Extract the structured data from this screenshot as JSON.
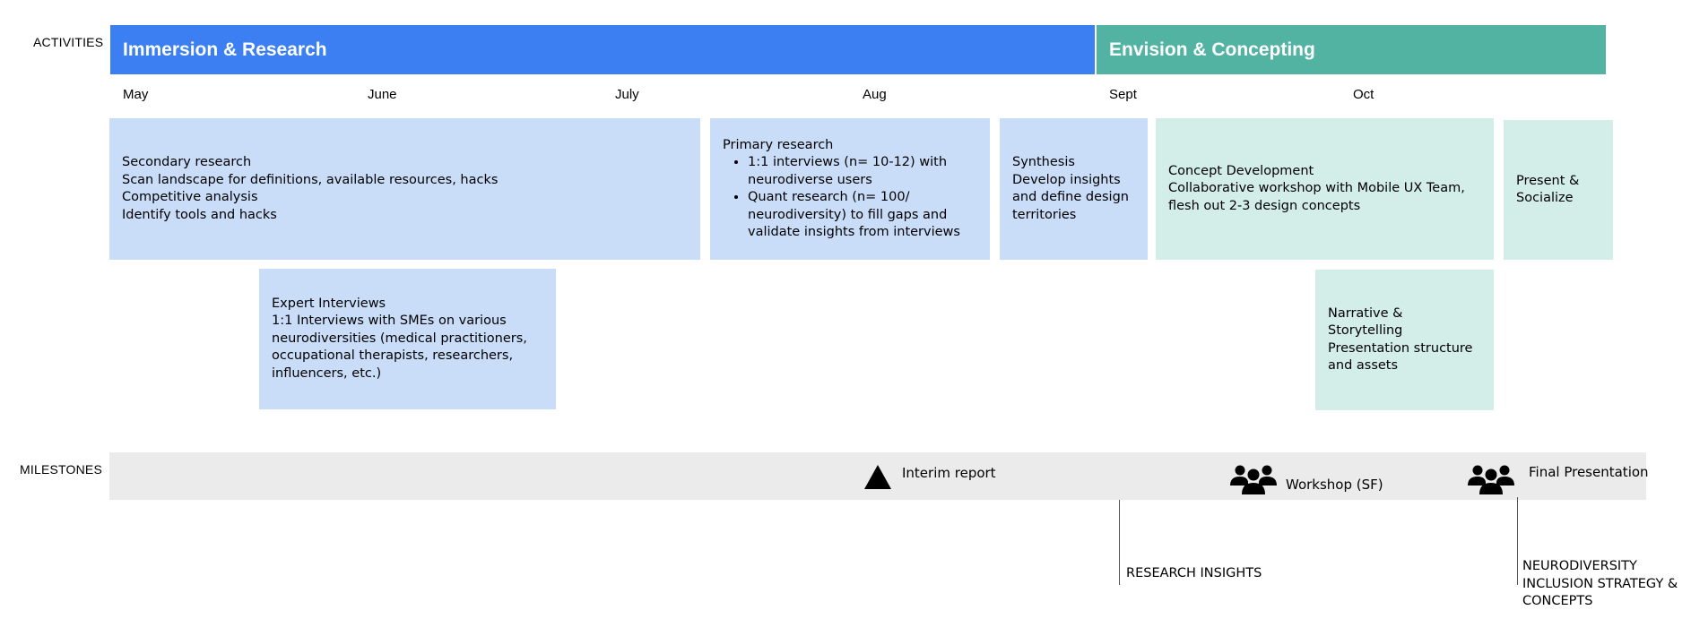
{
  "labels": {
    "activities": "ACTIVITIES",
    "milestones": "MILESTONES"
  },
  "colors": {
    "immersion": "#3b7ff2",
    "envision": "#52b3a3",
    "research_box": "#c9dcf8",
    "concept_box": "#d3ede8",
    "milestone_band": "#ebebeb"
  },
  "phases": {
    "immersion": "Immersion & Research",
    "envision": "Envision & Concepting"
  },
  "months": [
    "May",
    "June",
    "July",
    "Aug",
    "Sept",
    "Oct"
  ],
  "activities": {
    "secondary": {
      "lines": [
        "Secondary research",
        "Scan landscape for definitions, available resources, hacks",
        "Competitive analysis",
        "Identify tools and hacks"
      ]
    },
    "primary": {
      "title": "Primary research",
      "bullets": [
        "1:1 interviews  (n= 10-12) with neurodiverse users",
        "Quant research (n= 100/ neurodiversity) to fill gaps and validate insights from interviews"
      ]
    },
    "synthesis": {
      "lines": [
        "Synthesis",
        "Develop insights and define design territories"
      ]
    },
    "concept": {
      "lines": [
        "Concept Development",
        "Collaborative workshop with Mobile UX Team, flesh out 2-3 design concepts"
      ]
    },
    "present": {
      "lines": [
        "Present &",
        "Socialize"
      ]
    },
    "expert": {
      "lines": [
        "Expert Interviews",
        "1:1 Interviews with SMEs on various neurodiversities (medical practitioners, occupational therapists, researchers, influencers, etc.)"
      ]
    },
    "narrative": {
      "lines": [
        "Narrative & Storytelling",
        "Presentation structure and assets"
      ]
    }
  },
  "milestones": {
    "interim": {
      "label": "Interim report",
      "icon": "triangle-icon"
    },
    "workshop": {
      "label": "Workshop (SF)",
      "icon": "group-icon"
    },
    "final": {
      "label": "Final Presentation",
      "icon": "group-icon"
    }
  },
  "outcomes": {
    "research": "RESEARCH INSIGHTS",
    "strategy": [
      "NEURODIVERSITY",
      "INCLUSION STRATEGY &",
      "CONCEPTS"
    ]
  }
}
